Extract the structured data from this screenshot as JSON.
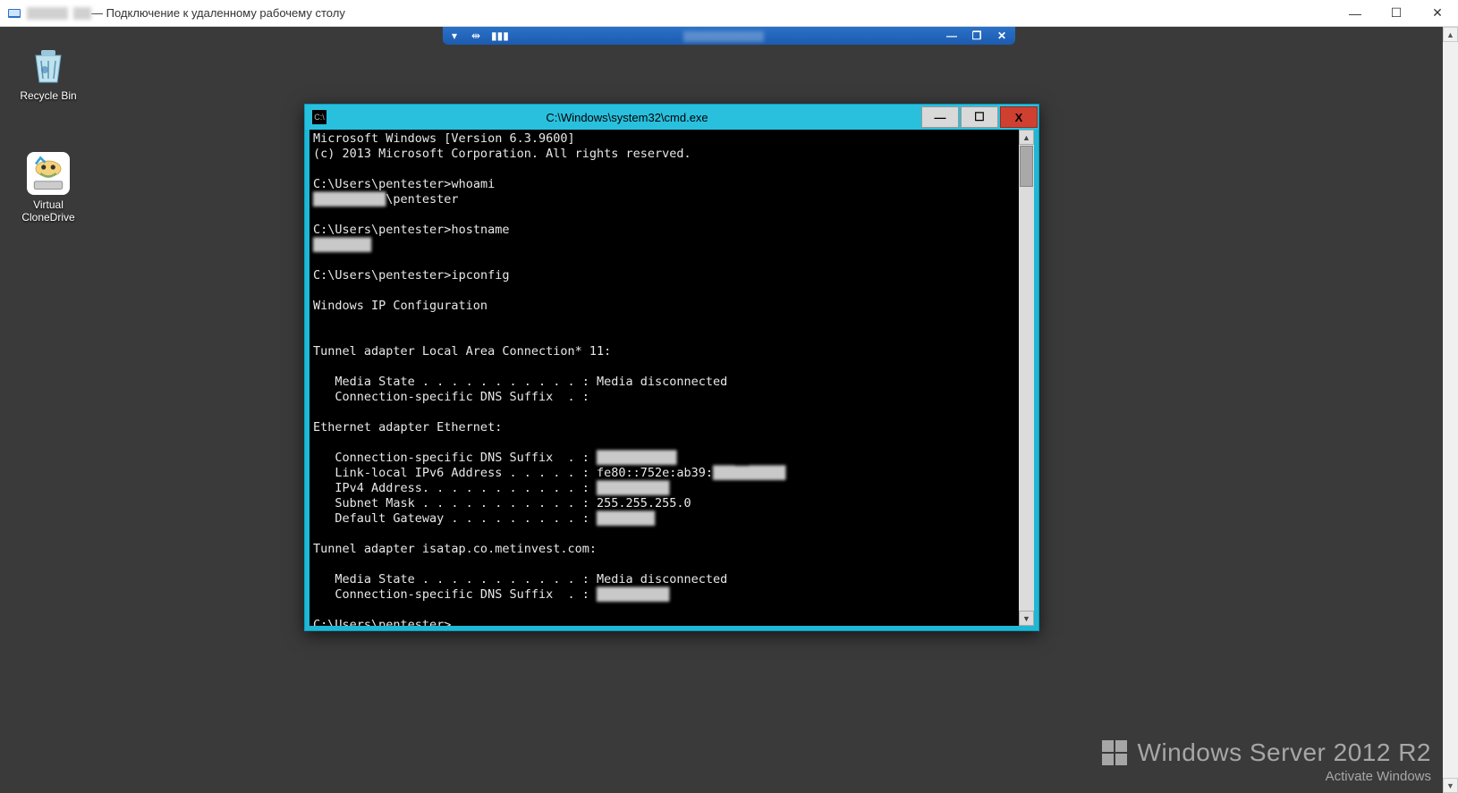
{
  "rdp": {
    "app_title_suffix": " — Подключение к удаленному рабочему столу",
    "redacted_host_width_a": "46px",
    "redacted_host_width_b": "20px",
    "min_glyph": "—",
    "max_glyph": "☐",
    "close_glyph": "✕"
  },
  "conn_bar": {
    "pin_glyph": "▾",
    "drag_glyph": "⇹",
    "signal_glyph": "▮▮▮",
    "min_glyph": "—",
    "restore_glyph": "❐",
    "close_glyph": "✕"
  },
  "desktop": {
    "icons": [
      {
        "name": "recycle-bin",
        "label": "Recycle Bin"
      },
      {
        "name": "virtual-clonedrive",
        "label": "Virtual\nCloneDrive"
      }
    ]
  },
  "watermark": {
    "product": "Windows Server 2012 R2",
    "activate": "Activate Windows"
  },
  "cmd": {
    "title": "C:\\Windows\\system32\\cmd.exe",
    "min_glyph": "—",
    "max_glyph": "☐",
    "close_glyph": "X",
    "lines": {
      "l00": "Microsoft Windows [Version 6.3.9600]",
      "l01": "(c) 2013 Microsoft Corporation. All rights reserved.",
      "l02": "",
      "l03a": "C:\\Users\\pentester>",
      "l03b": "whoami",
      "l04a_redact": "██████████",
      "l04b": "\\pentester",
      "l05": "",
      "l06a": "C:\\Users\\pentester>",
      "l06b": "hostname",
      "l07_redact": "████████",
      "l08": "",
      "l09a": "C:\\Users\\pentester>",
      "l09b": "ipconfig",
      "l10": "",
      "l11": "Windows IP Configuration",
      "l12": "",
      "l13": "",
      "l14": "Tunnel adapter Local Area Connection* 11:",
      "l15": "",
      "l16": "   Media State . . . . . . . . . . . : Media disconnected",
      "l17": "   Connection-specific DNS Suffix  . :",
      "l18": "",
      "l19": "Ethernet adapter Ethernet:",
      "l20": "",
      "l21a": "   Connection-specific DNS Suffix  . : ",
      "l21b_redact": "███████████",
      "l22a": "   Link-local IPv6 Address . . . . . : fe80::752e:ab39:",
      "l22b_redact": "███  █████",
      "l23a": "   IPv4 Address. . . . . . . . . . . : ",
      "l23b_redact": "██████████",
      "l24": "   Subnet Mask . . . . . . . . . . . : 255.255.255.0",
      "l25a": "   Default Gateway . . . . . . . . . : ",
      "l25b_redact": "████████",
      "l26": "",
      "l27": "Tunnel adapter isatap.co.metinvest.com:",
      "l28": "",
      "l29": "   Media State . . . . . . . . . . . : Media disconnected",
      "l30a": "   Connection-specific DNS Suffix  . : ",
      "l30b_redact": "██████████",
      "l31": "",
      "l32": "C:\\Users\\pentester>"
    }
  }
}
